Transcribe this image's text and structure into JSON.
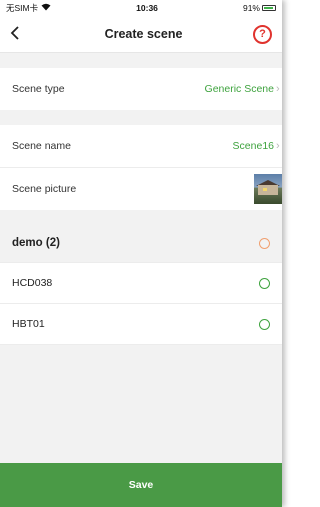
{
  "status_bar": {
    "carrier": "无SIM卡",
    "time": "10:36",
    "battery": "91%"
  },
  "nav": {
    "title": "Create scene",
    "help_icon": "question-circle-icon",
    "back_icon": "chevron-left-icon"
  },
  "scene_type": {
    "label": "Scene type",
    "value": "Generic Scene"
  },
  "scene_name": {
    "label": "Scene name",
    "value": "Scene16"
  },
  "scene_picture": {
    "label": "Scene picture"
  },
  "group": {
    "title": "demo (2)"
  },
  "devices": [
    {
      "name": "HCD038"
    },
    {
      "name": "HBT01"
    }
  ],
  "save_label": "Save",
  "colors": {
    "accent": "#3fa33f",
    "save_bar": "#4a9a46",
    "help": "#e0332e"
  }
}
